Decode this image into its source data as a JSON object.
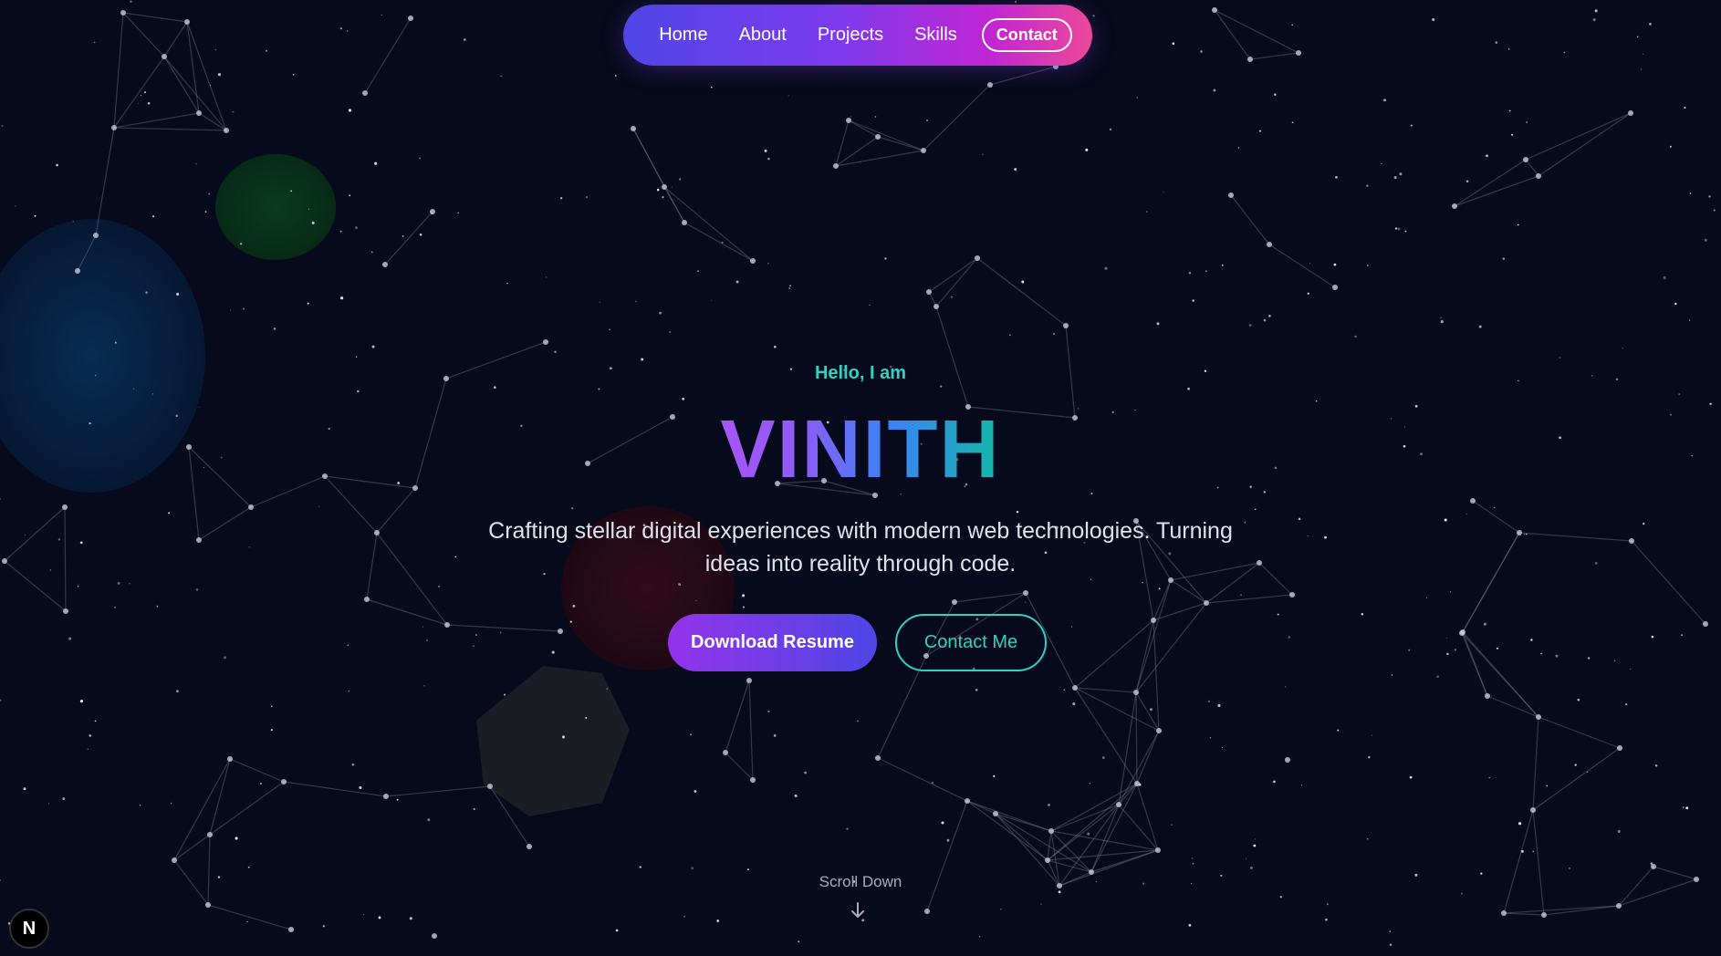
{
  "nav": {
    "items": [
      {
        "label": "Home"
      },
      {
        "label": "About"
      },
      {
        "label": "Projects"
      },
      {
        "label": "Skills"
      }
    ],
    "contact_label": "Contact"
  },
  "hero": {
    "greeting": "Hello, I am",
    "name": "VINITH",
    "description": "Crafting stellar digital experiences with modern web technologies. Turning ideas into reality through code.",
    "primary_button": "Download Resume",
    "secondary_button": "Contact Me"
  },
  "scroll": {
    "label": "Scroll Down"
  },
  "badge": {
    "letter": "N"
  },
  "colors": {
    "background": "#070a1c",
    "accent_teal": "#2dd4bf",
    "accent_purple": "#9333ea",
    "nav_gradient_start": "#4f46e5",
    "nav_gradient_end": "#ec4899"
  }
}
